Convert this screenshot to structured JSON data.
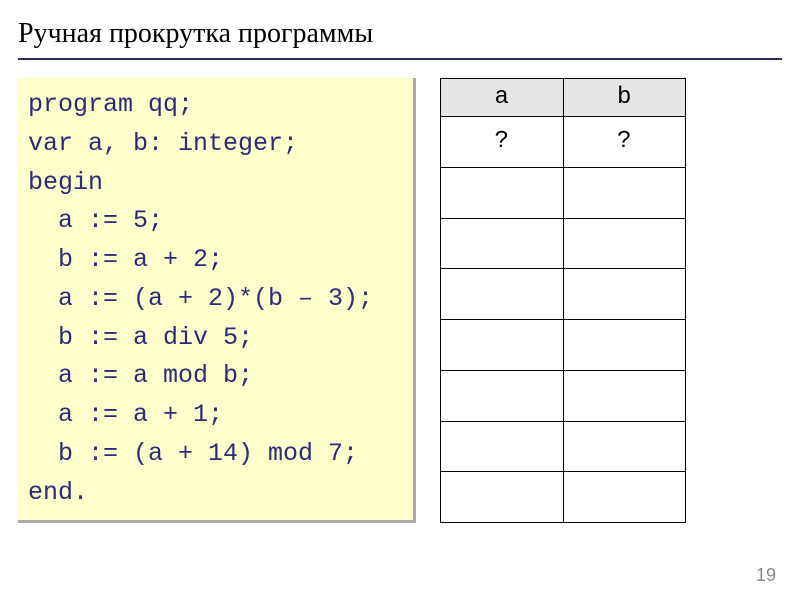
{
  "title": "Ручная прокрутка программы",
  "code": {
    "lines": [
      "program qq;",
      "var a, b: integer;",
      "begin",
      "  a := 5;",
      "  b := a + 2;",
      "  a := (a + 2)*(b – 3);",
      "  b := a div 5;",
      "  a := a mod b;",
      "  a := a + 1;",
      "  b := (a + 14) mod 7;",
      "end."
    ]
  },
  "table": {
    "headers": [
      "a",
      "b"
    ],
    "rows": [
      [
        "?",
        "?"
      ],
      [
        "",
        ""
      ],
      [
        "",
        ""
      ],
      [
        "",
        ""
      ],
      [
        "",
        ""
      ],
      [
        "",
        ""
      ],
      [
        "",
        ""
      ],
      [
        "",
        ""
      ]
    ]
  },
  "page_number": "19"
}
